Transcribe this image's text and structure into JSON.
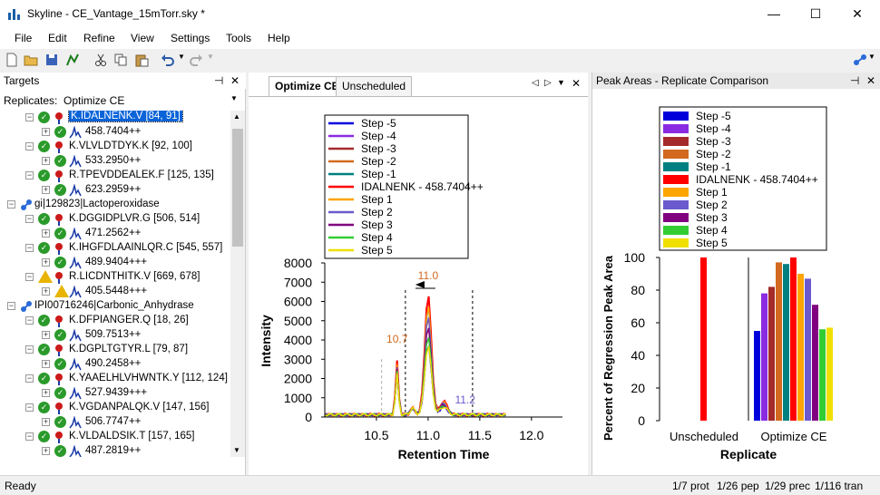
{
  "window": {
    "title": "Skyline - CE_Vantage_15mTorr.sky *",
    "minimize": "—",
    "maximize": "☐",
    "close": "✕"
  },
  "menu": [
    "File",
    "Edit",
    "Refine",
    "View",
    "Settings",
    "Tools",
    "Help"
  ],
  "targets": {
    "title": "Targets",
    "pin": "⊣",
    "close": "✕",
    "replicates_label": "Replicates:",
    "replicates_value": "Optimize CE",
    "rows": [
      {
        "kind": "peptide",
        "text": "K.IDALNENK.V [84, 91]",
        "status": "ok",
        "selected": true
      },
      {
        "kind": "precursor",
        "text": "458.7404++",
        "status": "ok"
      },
      {
        "kind": "peptide",
        "text": "K.VLVLDTDYK.K [92, 100]",
        "status": "ok"
      },
      {
        "kind": "precursor",
        "text": "533.2950++",
        "status": "ok"
      },
      {
        "kind": "peptide",
        "text": "R.TPEVDDEALEK.F [125, 135]",
        "status": "ok"
      },
      {
        "kind": "precursor",
        "text": "623.2959++",
        "status": "ok"
      },
      {
        "kind": "protein",
        "text": "gi|129823|Lactoperoxidase"
      },
      {
        "kind": "peptide",
        "text": "K.DGGIDPLVR.G [506, 514]",
        "status": "ok"
      },
      {
        "kind": "precursor",
        "text": "471.2562++",
        "status": "ok"
      },
      {
        "kind": "peptide",
        "text": "K.IHGFDLAAINLQR.C [545, 557]",
        "status": "ok"
      },
      {
        "kind": "precursor",
        "text": "489.9404+++",
        "status": "ok"
      },
      {
        "kind": "peptide",
        "text": "R.LICDNTHITK.V [669, 678]",
        "status": "warn"
      },
      {
        "kind": "precursor",
        "text": "405.5448+++",
        "status": "warn"
      },
      {
        "kind": "protein",
        "text": "IPI00716246|Carbonic_Anhydrase"
      },
      {
        "kind": "peptide",
        "text": "K.DFPIANGER.Q [18, 26]",
        "status": "ok"
      },
      {
        "kind": "precursor",
        "text": "509.7513++",
        "status": "ok"
      },
      {
        "kind": "peptide",
        "text": "K.DGPLTGTYR.L [79, 87]",
        "status": "ok"
      },
      {
        "kind": "precursor",
        "text": "490.2458++",
        "status": "ok"
      },
      {
        "kind": "peptide",
        "text": "K.YAAELHLVHWNTK.Y [112, 124]",
        "status": "ok"
      },
      {
        "kind": "precursor",
        "text": "527.9439+++",
        "status": "ok"
      },
      {
        "kind": "peptide",
        "text": "K.VGDANPALQK.V [147, 156]",
        "status": "ok"
      },
      {
        "kind": "precursor",
        "text": "506.7747++",
        "status": "ok"
      },
      {
        "kind": "peptide",
        "text": "K.VLDALDSIK.T [157, 165]",
        "status": "ok"
      },
      {
        "kind": "precursor",
        "text": "487.2819++",
        "status": "ok"
      }
    ]
  },
  "chromatogram": {
    "tabs": [
      "Optimize CE",
      "Unscheduled"
    ],
    "legend": [
      {
        "name": "Step -5",
        "color": "#0000dd"
      },
      {
        "name": "Step -4",
        "color": "#8a2be2"
      },
      {
        "name": "Step -3",
        "color": "#a52a2a"
      },
      {
        "name": "Step -2",
        "color": "#d2691e"
      },
      {
        "name": "Step -1",
        "color": "#008080"
      },
      {
        "name": "IDALNENK - 458.7404++",
        "color": "#ff0000"
      },
      {
        "name": "Step 1",
        "color": "#ffa500"
      },
      {
        "name": "Step 2",
        "color": "#6a5acd"
      },
      {
        "name": "Step 3",
        "color": "#800080"
      },
      {
        "name": "Step 4",
        "color": "#32cd32"
      },
      {
        "name": "Step 5",
        "color": "#f0e000"
      }
    ],
    "annotations": [
      "11.0",
      "10.7",
      "11.2"
    ],
    "annotation_colors": [
      "#d2691e",
      "#d2691e",
      "#6a5acd"
    ]
  },
  "peak_areas": {
    "title": "Peak Areas - Replicate Comparison",
    "pin": "⊣",
    "close": "✕"
  },
  "chart_data": [
    {
      "type": "line",
      "xlabel": "Retention Time",
      "ylabel": "Intensity",
      "xlim": [
        10.0,
        12.3
      ],
      "ylim": [
        0,
        8000
      ],
      "xticks": [
        "10.5",
        "11.0",
        "11.5",
        "12.0"
      ],
      "yticks": [
        "0",
        "1000",
        "2000",
        "3000",
        "4000",
        "5000",
        "6000",
        "7000",
        "8000"
      ],
      "peaks": [
        {
          "label": "11.0",
          "x": 11.0,
          "y": 6400
        },
        {
          "label": "10.7",
          "x": 10.7,
          "y": 3200
        },
        {
          "label": "11.2",
          "x": 11.2,
          "y": 800
        }
      ]
    },
    {
      "type": "bar",
      "xlabel": "Replicate",
      "ylabel": "Percent of Regression Peak Area",
      "ylim": [
        0,
        100
      ],
      "yticks": [
        "0",
        "20",
        "40",
        "60",
        "80",
        "100"
      ],
      "categories": [
        "Unscheduled",
        "Optimize CE"
      ],
      "series": [
        {
          "name": "Step -5",
          "color": "#0000dd",
          "values": [
            null,
            55
          ]
        },
        {
          "name": "Step -4",
          "color": "#8a2be2",
          "values": [
            null,
            78
          ]
        },
        {
          "name": "Step -3",
          "color": "#a52a2a",
          "values": [
            null,
            82
          ]
        },
        {
          "name": "Step -2",
          "color": "#d2691e",
          "values": [
            null,
            97
          ]
        },
        {
          "name": "Step -1",
          "color": "#008080",
          "values": [
            null,
            96
          ]
        },
        {
          "name": "IDALNENK - 458.7404++",
          "color": "#ff0000",
          "values": [
            100,
            100
          ]
        },
        {
          "name": "Step 1",
          "color": "#ffa500",
          "values": [
            null,
            90
          ]
        },
        {
          "name": "Step 2",
          "color": "#6a5acd",
          "values": [
            null,
            87
          ]
        },
        {
          "name": "Step 3",
          "color": "#800080",
          "values": [
            null,
            71
          ]
        },
        {
          "name": "Step 4",
          "color": "#32cd32",
          "values": [
            null,
            56
          ]
        },
        {
          "name": "Step 5",
          "color": "#f0e000",
          "values": [
            null,
            57
          ]
        }
      ]
    }
  ],
  "status": {
    "ready": "Ready",
    "prot": "1/7 prot",
    "pep": "1/26 pep",
    "prec": "1/29 prec",
    "tran": "1/116 tran"
  }
}
